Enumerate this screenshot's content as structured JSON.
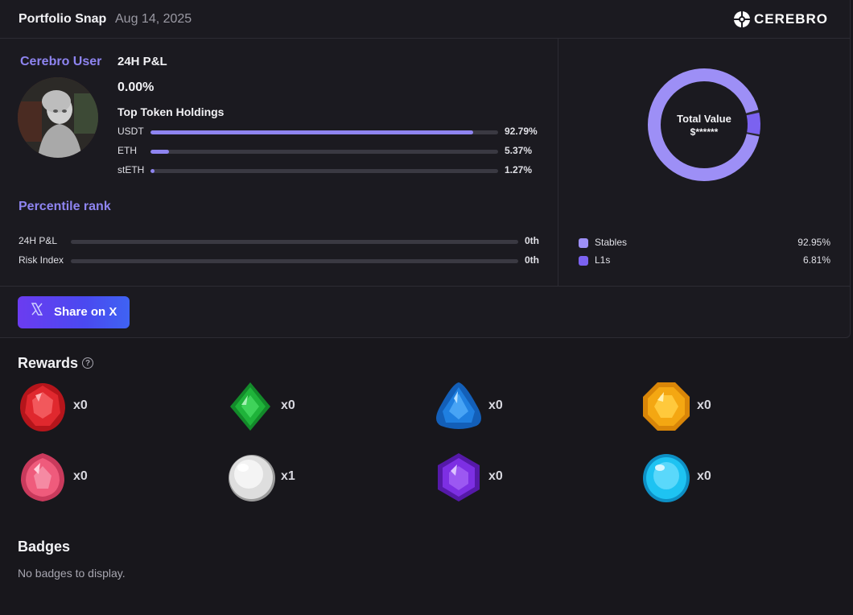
{
  "header": {
    "title": "Portfolio Snap",
    "date": "Aug 14, 2025",
    "brand": "CEREBRO"
  },
  "profile": {
    "user_name": "Cerebro User",
    "pnl_label": "24H P&L",
    "pnl_value": "0.00%"
  },
  "holdings": {
    "title": "Top Token Holdings",
    "items": [
      {
        "symbol": "USDT",
        "percent": "92.79%",
        "fraction": 0.9279
      },
      {
        "symbol": "ETH",
        "percent": "5.37%",
        "fraction": 0.0537
      },
      {
        "symbol": "stETH",
        "percent": "1.27%",
        "fraction": 0.0127
      }
    ]
  },
  "percentile": {
    "title": "Percentile rank",
    "items": [
      {
        "label": "24H P&L",
        "value": "0th",
        "fraction": 0
      },
      {
        "label": "Risk Index",
        "value": "0th",
        "fraction": 0
      }
    ]
  },
  "allocation": {
    "center_title": "Total Value",
    "center_value": "$******",
    "items": [
      {
        "name": "Stables",
        "value": "92.95%",
        "fraction": 0.9295,
        "color": "#9d8ff6"
      },
      {
        "name": "L1s",
        "value": "6.81%",
        "fraction": 0.0681,
        "color": "#7b62f0"
      }
    ]
  },
  "share": {
    "label": "Share on X"
  },
  "rewards": {
    "title": "Rewards",
    "items": [
      {
        "gem": "red-gem",
        "count": "x0",
        "color": "#e0282e"
      },
      {
        "gem": "green-gem",
        "count": "x0",
        "color": "#1fb33a"
      },
      {
        "gem": "blue-gem",
        "count": "x0",
        "color": "#1f7fe0"
      },
      {
        "gem": "orange-gem",
        "count": "x0",
        "color": "#f4a712"
      },
      {
        "gem": "pink-gem",
        "count": "x0",
        "color": "#ef5b7c"
      },
      {
        "gem": "pearl-gem",
        "count": "x1",
        "color": "#ececec"
      },
      {
        "gem": "purple-gem",
        "count": "x0",
        "color": "#7d2fe3"
      },
      {
        "gem": "cyan-gem",
        "count": "x0",
        "color": "#1ec3f2"
      }
    ]
  },
  "badges": {
    "title": "Badges",
    "empty_text": "No badges to display."
  }
}
